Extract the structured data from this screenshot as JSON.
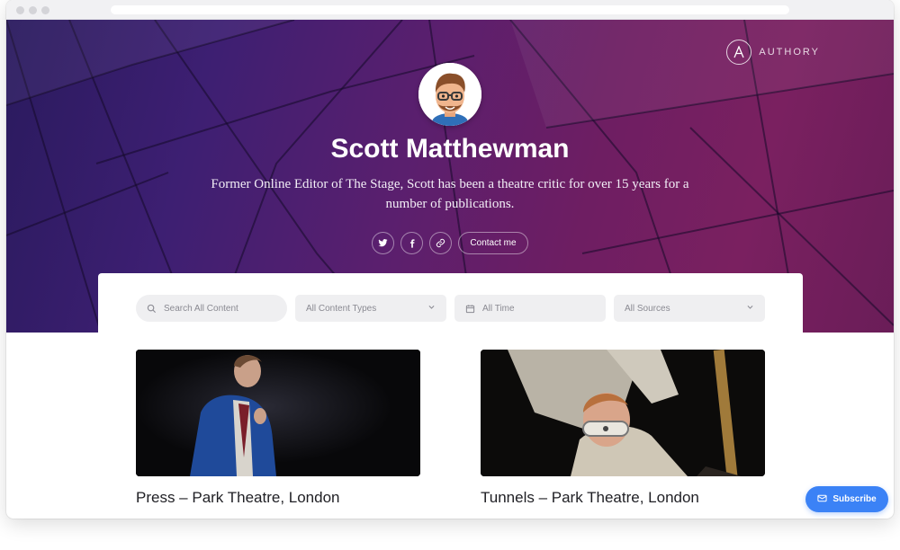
{
  "brand": {
    "name": "AUTHORY",
    "icon": "authory-logo-icon"
  },
  "profile": {
    "name": "Scott Matthewman",
    "bio": "Former Online Editor of The Stage, Scott has been a theatre critic for over 15 years for a number of publications.",
    "avatar": "memoji-avatar"
  },
  "socials": {
    "twitter": "twitter-icon",
    "facebook": "facebook-icon",
    "link": "link-icon",
    "contact_label": "Contact me"
  },
  "filters": {
    "search_placeholder": "Search All Content",
    "content_types": "All Content Types",
    "time": "All Time",
    "sources": "All Sources"
  },
  "articles": [
    {
      "title": "Press – Park Theatre, London"
    },
    {
      "title": "Tunnels – Park Theatre, London"
    }
  ],
  "subscribe_label": "Subscribe",
  "colors": {
    "accent": "#3b82f6",
    "hero_purple": "#5a1f6e",
    "hero_magenta": "#7a2060"
  }
}
